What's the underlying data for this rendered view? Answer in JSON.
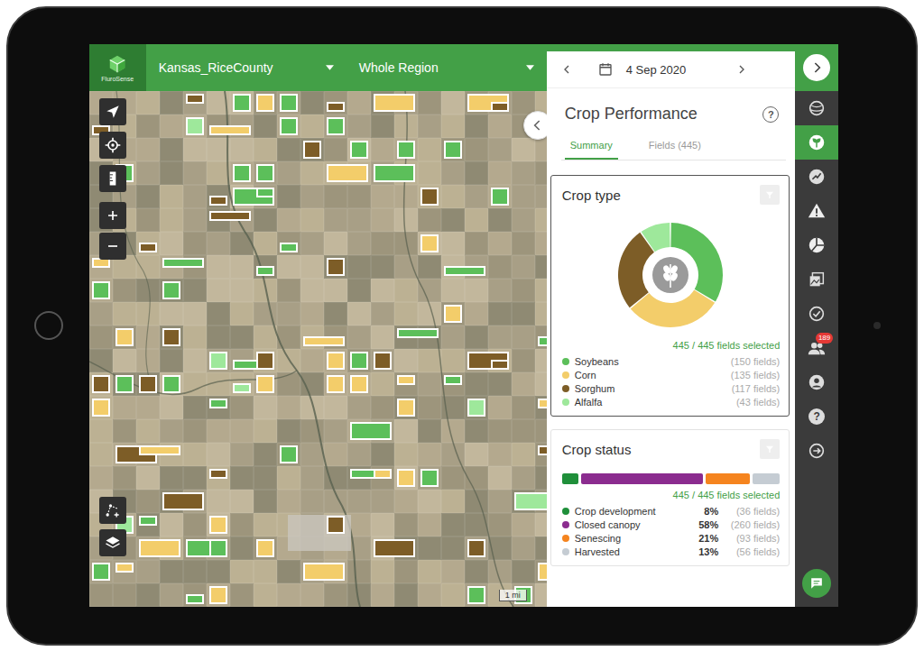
{
  "app": {
    "logo": "FluroSense",
    "region": "Kansas_RiceCounty",
    "scope": "Whole Region"
  },
  "date": "4 Sep 2020",
  "panel": {
    "title": "Crop Performance",
    "help_icon": "?",
    "tabs": [
      {
        "label": "Summary",
        "selected": true
      },
      {
        "label": "Fields (445)",
        "selected": false
      }
    ]
  },
  "crop_type": {
    "title": "Crop type",
    "selected": true,
    "selected_count": "445 / 445 fields selected",
    "chart": {
      "values": [
        150,
        135,
        117,
        43
      ]
    },
    "legend": [
      {
        "name": "Soybeans",
        "count": "(150 fields)",
        "color": "#5cbf5a"
      },
      {
        "name": "Corn",
        "count": "(135 fields)",
        "color": "#f3cd6a"
      },
      {
        "name": "Sorghum",
        "count": "(117 fields)",
        "color": "#7d5d27"
      },
      {
        "name": "Alfalfa",
        "count": "(43 fields)",
        "color": "#9ee89b"
      }
    ]
  },
  "crop_status": {
    "title": "Crop status",
    "selected": false,
    "selected_count": "445 / 445 fields selected",
    "items": [
      {
        "name": "Crop development",
        "percent": "8%",
        "count": "(36 fields)",
        "level": 0.08,
        "color": "#1f8f3a"
      },
      {
        "name": "Closed canopy",
        "percent": "58%",
        "count": "(260 fields)",
        "level": 0.58,
        "color": "#8b2c8f"
      },
      {
        "name": "Senescing",
        "percent": "21%",
        "count": "(93 fields)",
        "level": 0.21,
        "color": "#f5841f"
      },
      {
        "name": "Harvested",
        "percent": "13%",
        "count": "(56 fields)",
        "level": 0.13,
        "color": "#c5ccd3"
      }
    ]
  },
  "rail": [
    {
      "selected": false
    },
    {
      "selected": true
    },
    {
      "selected": false
    },
    {
      "selected": false
    },
    {
      "selected": false
    },
    {
      "selected": false
    },
    {
      "selected": false
    },
    {
      "selected": false,
      "badge": "189"
    },
    {
      "selected": false
    },
    {
      "selected": false,
      "glyph": "?"
    },
    {
      "selected": false
    }
  ],
  "map": {
    "scale": "1 mi"
  }
}
